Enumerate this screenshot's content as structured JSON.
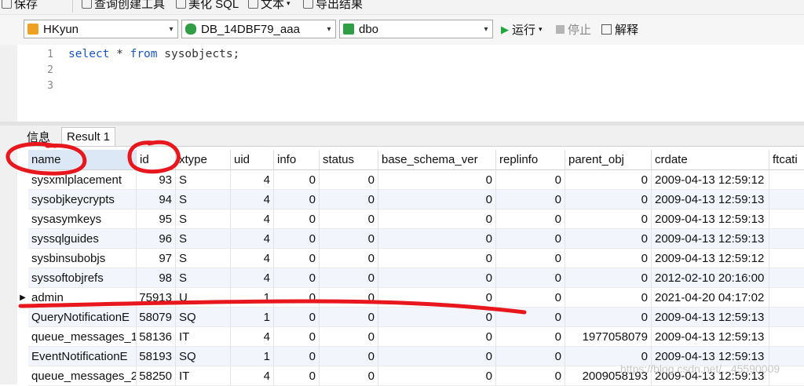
{
  "toolbar": {
    "save": "保存",
    "query_builder": "查询创建工具",
    "beautify_sql": "美化 SQL",
    "text": "文本",
    "export": "导出结果"
  },
  "selectors": {
    "connection": "HKyun",
    "database": "DB_14DBF79_aaa",
    "schema": "dbo"
  },
  "actions": {
    "run": "运行",
    "stop": "停止",
    "explain": "解释"
  },
  "editor": {
    "line_numbers": [
      "1",
      "2",
      "3"
    ],
    "kw_select": "select",
    "star": " * ",
    "kw_from": "from",
    "table": " sysobjects;"
  },
  "result_tabs": {
    "info": "信息",
    "result1": "Result 1"
  },
  "grid": {
    "columns": [
      "name",
      "id",
      "xtype",
      "uid",
      "info",
      "status",
      "base_schema_ver",
      "replinfo",
      "parent_obj",
      "crdate",
      "ftcati"
    ],
    "rows": [
      [
        "sysxmlplacement",
        "93",
        "S",
        "4",
        "0",
        "0",
        "0",
        "0",
        "0",
        "2009-04-13 12:59:12",
        ""
      ],
      [
        "sysobjkeycrypts",
        "94",
        "S",
        "4",
        "0",
        "0",
        "0",
        "0",
        "0",
        "2009-04-13 12:59:13",
        ""
      ],
      [
        "sysasymkeys",
        "95",
        "S",
        "4",
        "0",
        "0",
        "0",
        "0",
        "0",
        "2009-04-13 12:59:13",
        ""
      ],
      [
        "syssqlguides",
        "96",
        "S",
        "4",
        "0",
        "0",
        "0",
        "0",
        "0",
        "2009-04-13 12:59:13",
        ""
      ],
      [
        "sysbinsubobjs",
        "97",
        "S",
        "4",
        "0",
        "0",
        "0",
        "0",
        "0",
        "2009-04-13 12:59:12",
        ""
      ],
      [
        "syssoftobjrefs",
        "98",
        "S",
        "4",
        "0",
        "0",
        "0",
        "0",
        "0",
        "2012-02-10 20:16:00",
        ""
      ],
      [
        "admin",
        "75913",
        "U",
        "1",
        "0",
        "0",
        "0",
        "0",
        "0",
        "2021-04-20 04:17:02",
        ""
      ],
      [
        "QueryNotificationE",
        "58079",
        "SQ",
        "1",
        "0",
        "0",
        "0",
        "0",
        "0",
        "2009-04-13 12:59:13",
        ""
      ],
      [
        "queue_messages_1",
        "58136",
        "IT",
        "4",
        "0",
        "0",
        "0",
        "0",
        "1977058079",
        "2009-04-13 12:59:13",
        ""
      ],
      [
        "EventNotificationE",
        "58193",
        "SQ",
        "1",
        "0",
        "0",
        "0",
        "0",
        "0",
        "2009-04-13 12:59:13",
        ""
      ],
      [
        "queue_messages_2",
        "58250",
        "IT",
        "4",
        "0",
        "0",
        "0",
        "0",
        "2009058193",
        "2009-04-13 12:59:13",
        ""
      ]
    ],
    "current_row_marker": "▶"
  },
  "watermark": "https://blog.csdn.net/...45590009",
  "colors": {
    "keyword": "#1a56c8",
    "annotation": "#e8161d",
    "header_selected": "#dde8f7",
    "run_icon": "#1da93a"
  }
}
